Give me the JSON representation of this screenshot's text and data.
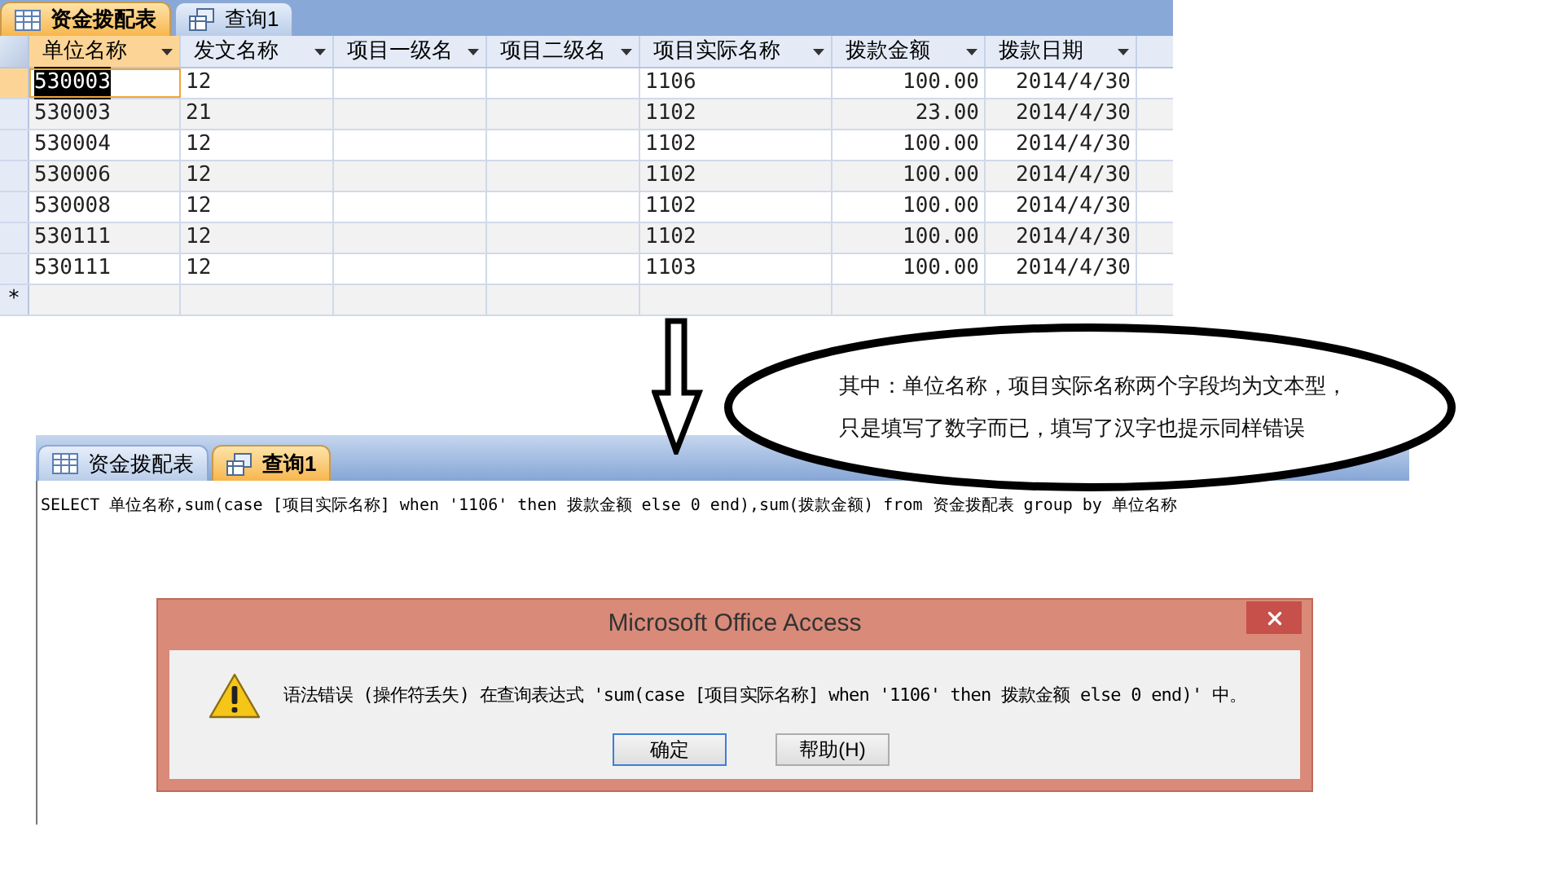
{
  "datasheet": {
    "tabs": [
      {
        "label": "资金拨配表",
        "selected": true
      },
      {
        "label": "查询1",
        "selected": false
      }
    ],
    "columns": [
      {
        "label": "单位名称",
        "kind": "text"
      },
      {
        "label": "发文名称",
        "kind": "text"
      },
      {
        "label": "项目一级名",
        "kind": "text"
      },
      {
        "label": "项目二级名",
        "kind": "text"
      },
      {
        "label": "项目实际名称",
        "kind": "text"
      },
      {
        "label": "拨款金额",
        "kind": "number"
      },
      {
        "label": "拨款日期",
        "kind": "number"
      }
    ],
    "rows": [
      {
        "selected": true,
        "cells": [
          "530003",
          "12",
          "",
          "",
          "1106",
          "100.00",
          "2014/4/30"
        ]
      },
      {
        "selected": false,
        "cells": [
          "530003",
          "21",
          "",
          "",
          "1102",
          "23.00",
          "2014/4/30"
        ]
      },
      {
        "selected": false,
        "cells": [
          "530004",
          "12",
          "",
          "",
          "1102",
          "100.00",
          "2014/4/30"
        ]
      },
      {
        "selected": false,
        "cells": [
          "530006",
          "12",
          "",
          "",
          "1102",
          "100.00",
          "2014/4/30"
        ]
      },
      {
        "selected": false,
        "cells": [
          "530008",
          "12",
          "",
          "",
          "1102",
          "100.00",
          "2014/4/30"
        ]
      },
      {
        "selected": false,
        "cells": [
          "530111",
          "12",
          "",
          "",
          "1102",
          "100.00",
          "2014/4/30"
        ]
      },
      {
        "selected": false,
        "cells": [
          "530111",
          "12",
          "",
          "",
          "1103",
          "100.00",
          "2014/4/30"
        ]
      }
    ],
    "new_row_marker": "*"
  },
  "annotation": {
    "lines": [
      "其中：单位名称，项目实际名称两个字段均为文本型，",
      "只是填写了数字而已，填写了汉字也提示同样错误"
    ]
  },
  "query_window": {
    "tabs": [
      {
        "label": "资金拨配表",
        "selected": false
      },
      {
        "label": "查询1",
        "selected": true
      }
    ],
    "sql": "SELECT 单位名称,sum(case [项目实际名称] when '1106' then 拨款金额 else 0 end),sum(拨款金额) from 资金拨配表 group by 单位名称"
  },
  "dialog": {
    "title": "Microsoft Office Access",
    "message": "语法错误 (操作符丢失) 在查询表达式 'sum(case [项目实际名称] when '1106' then 拨款金额 else 0 end)' 中。",
    "buttons": [
      {
        "label": "确定",
        "default": true
      },
      {
        "label": "帮助(H)",
        "default": false
      }
    ]
  }
}
